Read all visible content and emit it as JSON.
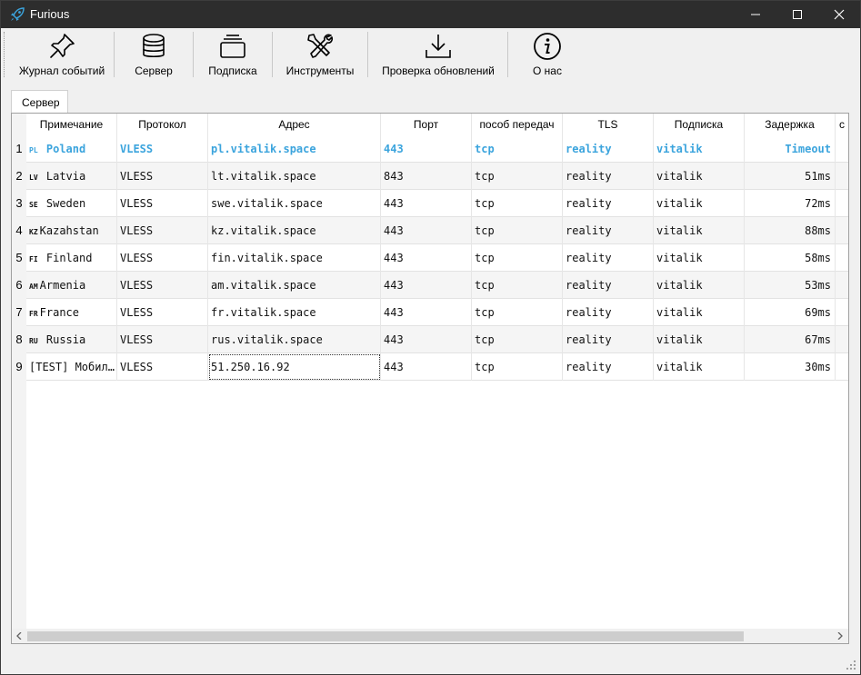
{
  "window": {
    "title": "Furious",
    "colors": {
      "titlebar": "#2d2d2d",
      "accent": "#3ba4dd"
    }
  },
  "toolbar": {
    "items": [
      {
        "label": "Журнал событий",
        "icon": "pin-icon"
      },
      {
        "label": "Сервер",
        "icon": "database-icon"
      },
      {
        "label": "Подписка",
        "icon": "stack-icon"
      },
      {
        "label": "Инструменты",
        "icon": "tools-icon"
      },
      {
        "label": "Проверка обновлений",
        "icon": "download-icon"
      },
      {
        "label": "О нас",
        "icon": "info-icon"
      }
    ]
  },
  "tabs": [
    {
      "label": "Сервер",
      "active": true
    }
  ],
  "table": {
    "columns": [
      "Примечание",
      "Протокол",
      "Адрес",
      "Порт",
      "пособ передач",
      "TLS",
      "Подписка",
      "Задержка",
      "с"
    ],
    "rows": [
      {
        "num": "1",
        "cc": "PL",
        "name": " Poland",
        "protocol": "VLESS",
        "address": "pl.vitalik.space",
        "port": "443",
        "transport": "tcp",
        "tls": "reality",
        "subscription": "vitalik",
        "latency": "Timeout",
        "highlight": true
      },
      {
        "num": "2",
        "cc": "LV",
        "name": " Latvia",
        "protocol": "VLESS",
        "address": "lt.vitalik.space",
        "port": "843",
        "transport": "tcp",
        "tls": "reality",
        "subscription": "vitalik",
        "latency": "51ms"
      },
      {
        "num": "3",
        "cc": "SE",
        "name": " Sweden",
        "protocol": "VLESS",
        "address": "swe.vitalik.space",
        "port": "443",
        "transport": "tcp",
        "tls": "reality",
        "subscription": "vitalik",
        "latency": "72ms"
      },
      {
        "num": "4",
        "cc": "KZ",
        "name": "Kazahstan",
        "protocol": "VLESS",
        "address": "kz.vitalik.space",
        "port": "443",
        "transport": "tcp",
        "tls": "reality",
        "subscription": "vitalik",
        "latency": "88ms"
      },
      {
        "num": "5",
        "cc": "FI",
        "name": " Finland",
        "protocol": "VLESS",
        "address": "fin.vitalik.space",
        "port": "443",
        "transport": "tcp",
        "tls": "reality",
        "subscription": "vitalik",
        "latency": "58ms"
      },
      {
        "num": "6",
        "cc": "AM",
        "name": "Armenia",
        "protocol": "VLESS",
        "address": "am.vitalik.space",
        "port": "443",
        "transport": "tcp",
        "tls": "reality",
        "subscription": "vitalik",
        "latency": "53ms"
      },
      {
        "num": "7",
        "cc": "FR",
        "name": "France",
        "protocol": "VLESS",
        "address": "fr.vitalik.space",
        "port": "443",
        "transport": "tcp",
        "tls": "reality",
        "subscription": "vitalik",
        "latency": "69ms"
      },
      {
        "num": "8",
        "cc": "RU",
        "name": " Russia",
        "protocol": "VLESS",
        "address": "rus.vitalik.space",
        "port": "443",
        "transport": "tcp",
        "tls": "reality",
        "subscription": "vitalik",
        "latency": "67ms"
      },
      {
        "num": "9",
        "cc": "",
        "name": "[TEST] Мобил…",
        "protocol": "VLESS",
        "address": "51.250.16.92",
        "port": "443",
        "transport": "tcp",
        "tls": "reality",
        "subscription": "vitalik",
        "latency": "30ms",
        "focus": true
      }
    ]
  }
}
